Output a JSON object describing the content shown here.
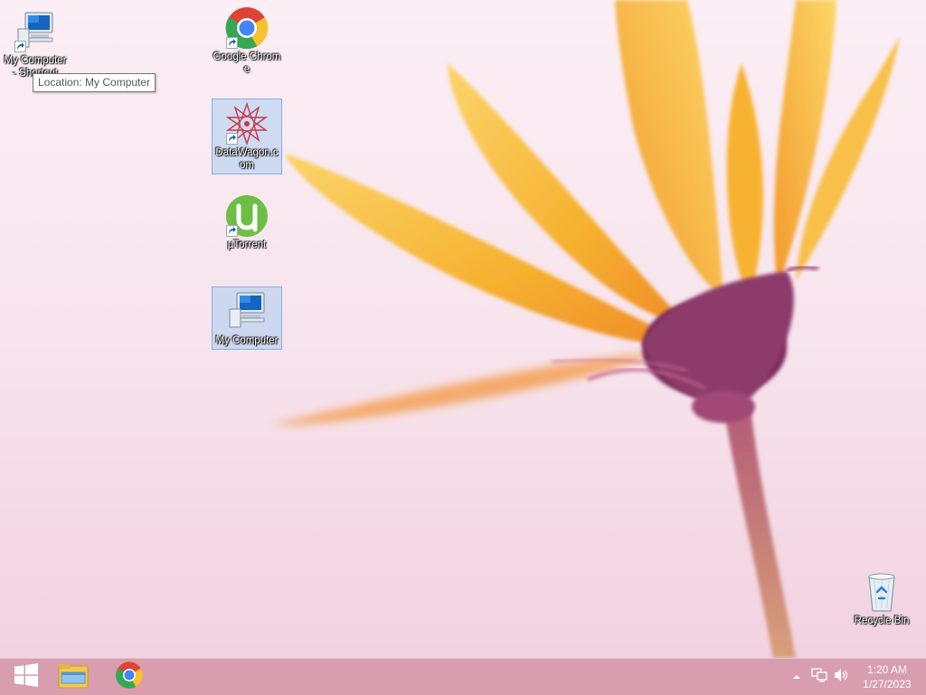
{
  "desktop": {
    "icons": [
      {
        "id": "my-computer-shortcut",
        "label": "My Computer - Shortcut",
        "icon": "computer-icon",
        "shortcut": true,
        "selected": false
      },
      {
        "id": "google-chrome",
        "label": "Google Chrome",
        "icon": "chrome-icon",
        "shortcut": true,
        "selected": false
      },
      {
        "id": "datawagon",
        "label": "DataWagon.com",
        "icon": "datawagon-icon",
        "shortcut": true,
        "selected": true
      },
      {
        "id": "utorrent",
        "label": "µTorrent",
        "icon": "utorrent-icon",
        "shortcut": true,
        "selected": false
      },
      {
        "id": "my-computer",
        "label": "My Computer",
        "icon": "computer-icon",
        "shortcut": false,
        "selected": true
      },
      {
        "id": "recycle-bin",
        "label": "Recycle Bin",
        "icon": "recycle-bin-icon",
        "shortcut": false,
        "selected": false
      }
    ],
    "tooltip": "Location: My Computer"
  },
  "taskbar": {
    "start_icon": "windows-logo-icon",
    "pinned": [
      {
        "name": "File Explorer",
        "icon": "file-explorer-icon"
      },
      {
        "name": "Google Chrome",
        "icon": "chrome-icon"
      }
    ],
    "tray": {
      "icons": [
        "show-hidden-icons-chevron",
        "network-icon",
        "volume-icon"
      ]
    },
    "clock": {
      "time": "1:20 AM",
      "date": "1/27/2023"
    }
  },
  "colors": {
    "taskbar": "#d696aa",
    "accent_flower": "#f6b02e",
    "flower_center": "#7a2a5a",
    "selection": "#aacdf0"
  }
}
